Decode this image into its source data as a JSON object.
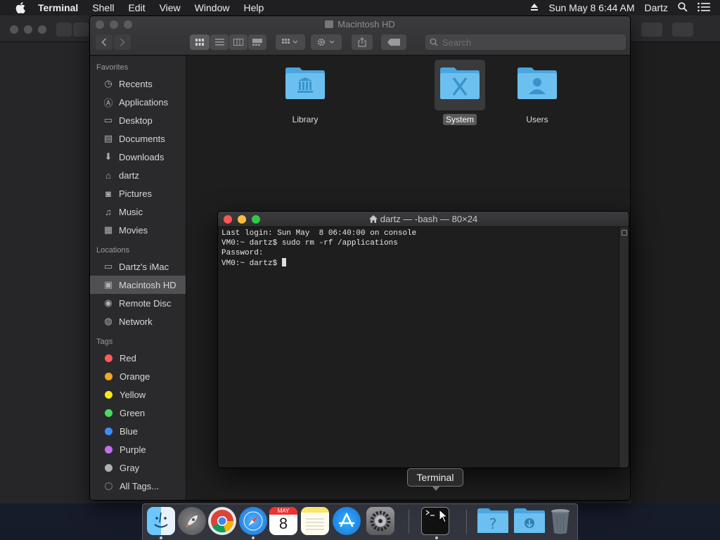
{
  "menubar": {
    "app_name": "Terminal",
    "menus": [
      "Shell",
      "Edit",
      "View",
      "Window",
      "Help"
    ],
    "clock": "Sun May 8  6:44 AM",
    "user": "Dartz"
  },
  "finder": {
    "title": "Macintosh HD",
    "search_placeholder": "Search",
    "sidebar": {
      "favorites_label": "Favorites",
      "favorites": [
        "Recents",
        "Applications",
        "Desktop",
        "Documents",
        "Downloads",
        "dartz",
        "Pictures",
        "Music",
        "Movies"
      ],
      "locations_label": "Locations",
      "locations": [
        "Dartz's iMac",
        "Macintosh HD",
        "Remote Disc",
        "Network"
      ],
      "tags_label": "Tags",
      "tags": [
        {
          "name": "Red",
          "color": "#ff5b5b"
        },
        {
          "name": "Orange",
          "color": "#f5a623"
        },
        {
          "name": "Yellow",
          "color": "#f8e71c"
        },
        {
          "name": "Green",
          "color": "#4cd964"
        },
        {
          "name": "Blue",
          "color": "#3b8dff"
        },
        {
          "name": "Purple",
          "color": "#c36ef0"
        },
        {
          "name": "Gray",
          "color": "#b0b0b0"
        }
      ],
      "all_tags": "All Tags..."
    },
    "folders": [
      "Library",
      "System",
      "Users"
    ]
  },
  "terminal": {
    "title": "dartz — -bash — 80×24",
    "lines": [
      "Last login: Sun May  8 06:40:00 on console",
      "VM0:~ dartz$ sudo rm -rf /applications",
      "Password:",
      "VM0:~ dartz$ "
    ]
  },
  "dock": {
    "tooltip": "Terminal",
    "calendar_month": "MAY",
    "calendar_day": "8"
  }
}
